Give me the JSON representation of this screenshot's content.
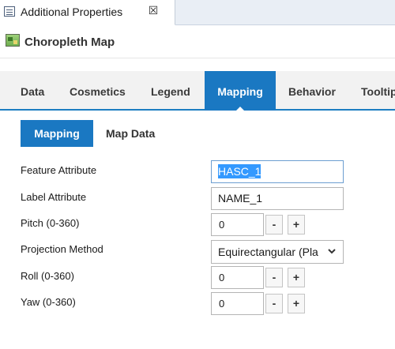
{
  "view_tab": {
    "title": "Additional Properties",
    "close_glyph": "☒",
    "icon": "properties-icon"
  },
  "editor": {
    "title": "Choropleth Map",
    "icon": "map-icon"
  },
  "prop_tabs": [
    {
      "label": "Data",
      "active": false
    },
    {
      "label": "Cosmetics",
      "active": false
    },
    {
      "label": "Legend",
      "active": false
    },
    {
      "label": "Mapping",
      "active": true
    },
    {
      "label": "Behavior",
      "active": false
    },
    {
      "label": "Tooltip",
      "active": false
    }
  ],
  "sub_tabs": [
    {
      "label": "Mapping",
      "active": true
    },
    {
      "label": "Map Data",
      "active": false
    }
  ],
  "form": {
    "feature_attribute": {
      "label": "Feature Attribute",
      "value": "HASC_1"
    },
    "label_attribute": {
      "label": "Label Attribute",
      "value": "NAME_1"
    },
    "pitch": {
      "label": "Pitch (0-360)",
      "value": "0"
    },
    "projection": {
      "label": "Projection Method",
      "value": "Equirectangular (Pla"
    },
    "roll": {
      "label": "Roll (0-360)",
      "value": "0"
    },
    "yaw": {
      "label": "Yaw (0-360)",
      "value": "0"
    },
    "minus_label": "-",
    "plus_label": "+"
  },
  "colors": {
    "accent": "#1a78c2",
    "selection": "#3399ff"
  }
}
